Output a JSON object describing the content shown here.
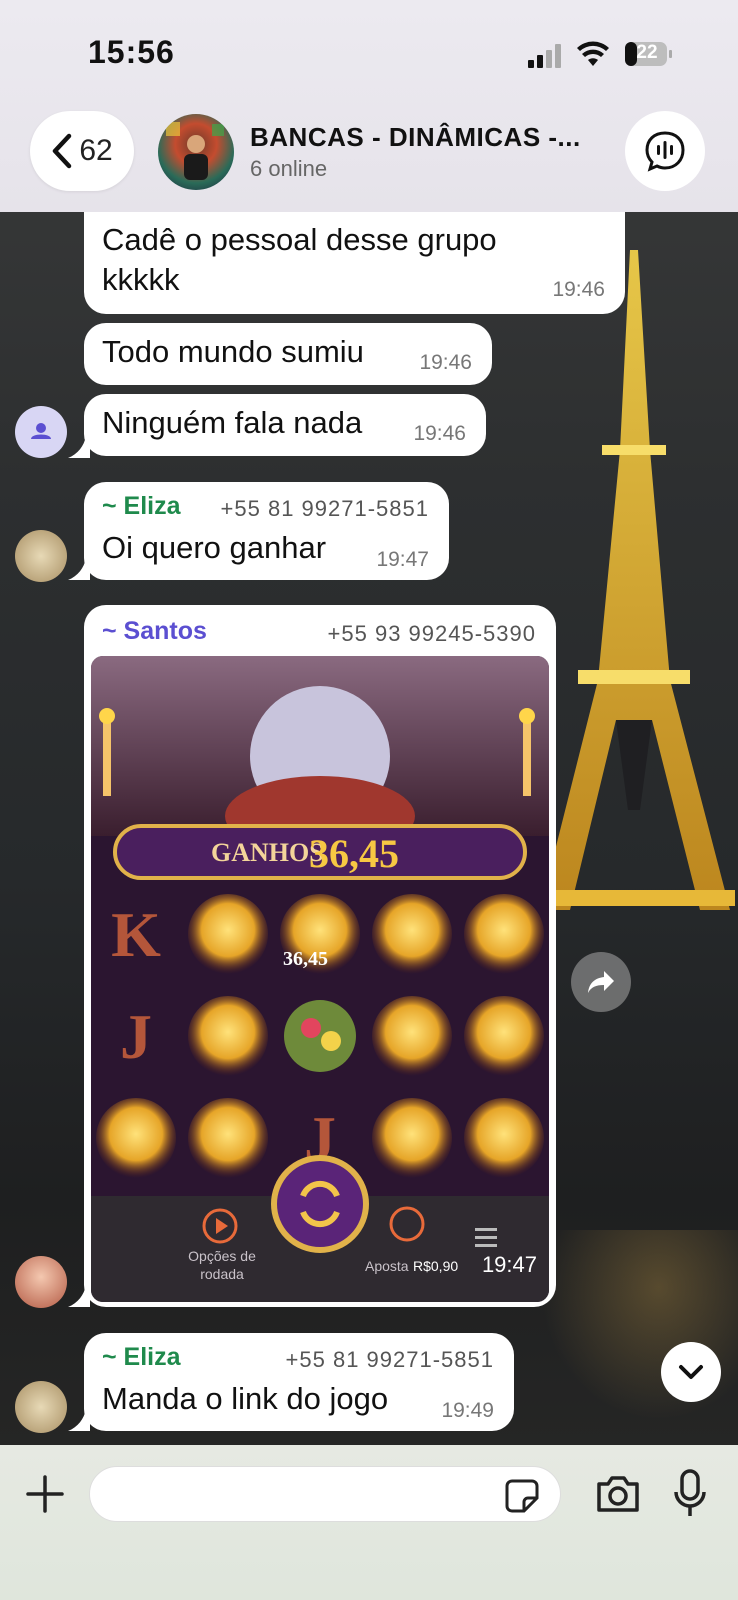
{
  "status_bar": {
    "time": "15:56",
    "battery": "22"
  },
  "header": {
    "back_count": "62",
    "group_title": "BANCAS - DINÂMICAS -...",
    "group_subtitle": "6 online"
  },
  "messages": [
    {
      "text_line1": "Cadê o pessoal desse grupo",
      "text_line2": "kkkkk",
      "time": "19:46"
    },
    {
      "text": "Todo mundo sumiu",
      "time": "19:46"
    },
    {
      "text": "Ninguém fala nada",
      "time": "19:46"
    },
    {
      "sender": "~ Eliza",
      "phone": "+55 81 99271-5851",
      "text": "Oi quero ganhar",
      "time": "19:47"
    },
    {
      "sender": "~ Santos",
      "phone": "+55 93 99245-5390",
      "time": "19:47"
    },
    {
      "sender": "~ Eliza",
      "phone": "+55 81 99271-5851",
      "text": "Manda o link do jogo",
      "time": "19:49"
    }
  ],
  "game": {
    "win_label": "GANHOS",
    "win_value": "36,45",
    "cell_win": "36,45",
    "options_line1": "Opções de",
    "options_line2": "rodada",
    "bet_label": "Aposta",
    "bet_value": "R$0,90"
  },
  "colors": {
    "eliza": "#1f8a4c",
    "santos": "#5b4fd1",
    "bubble": "#ffffff"
  },
  "composer": {
    "placeholder": ""
  }
}
